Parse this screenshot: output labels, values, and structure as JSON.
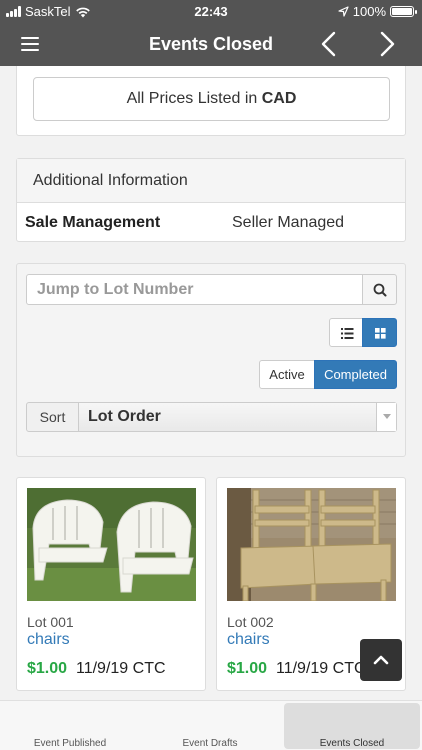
{
  "status_bar": {
    "carrier": "SaskTel",
    "time": "22:43",
    "battery": "100%"
  },
  "nav": {
    "title": "Events Closed",
    "menu_icon": "hamburger-menu-icon",
    "prev_icon": "chevron-left-icon",
    "next_icon": "chevron-right-icon"
  },
  "pricing": {
    "prefix": "All Prices Listed in",
    "currency": "CAD"
  },
  "additional_info": {
    "heading": "Additional Information",
    "key": "Sale Management",
    "value": "Seller Managed"
  },
  "filters": {
    "jump_placeholder": "Jump to Lot Number",
    "search_icon": "search-icon",
    "view_modes": [
      "list-view-icon",
      "grid-view-icon"
    ],
    "status_options": [
      "Active",
      "Completed"
    ],
    "status_selected": "Completed",
    "sort_label": "Sort",
    "sort_value": "Lot Order"
  },
  "lots": [
    {
      "lot": "Lot 001",
      "title": "chairs",
      "price": "$1.00",
      "date": "11/9/19 CTC"
    },
    {
      "lot": "Lot 002",
      "title": "chairs",
      "price": "$1.00",
      "date": "11/9/19 CTC"
    }
  ],
  "scroll_top_icon": "chevron-up-icon",
  "tabs": [
    {
      "label": "Event Published",
      "selected": false
    },
    {
      "label": "Event Drafts",
      "selected": false
    },
    {
      "label": "Events Closed",
      "selected": true
    }
  ],
  "colors": {
    "header": "#545454",
    "primary": "#337ab7",
    "price_green": "#28a745"
  }
}
